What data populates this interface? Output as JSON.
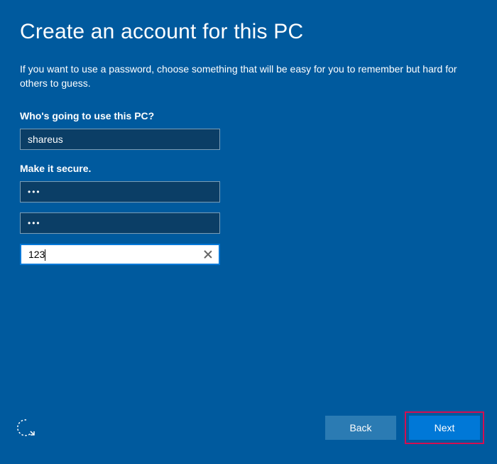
{
  "title": "Create an account for this PC",
  "subtitle": "If you want to use a password, choose something that will be easy for you to remember but hard for others to guess.",
  "user_section": {
    "label": "Who's going to use this PC?",
    "username": "shareus"
  },
  "security_section": {
    "label": "Make it secure.",
    "password": "•••",
    "confirm_password": "•••",
    "hint": "123"
  },
  "buttons": {
    "back": "Back",
    "next": "Next"
  }
}
